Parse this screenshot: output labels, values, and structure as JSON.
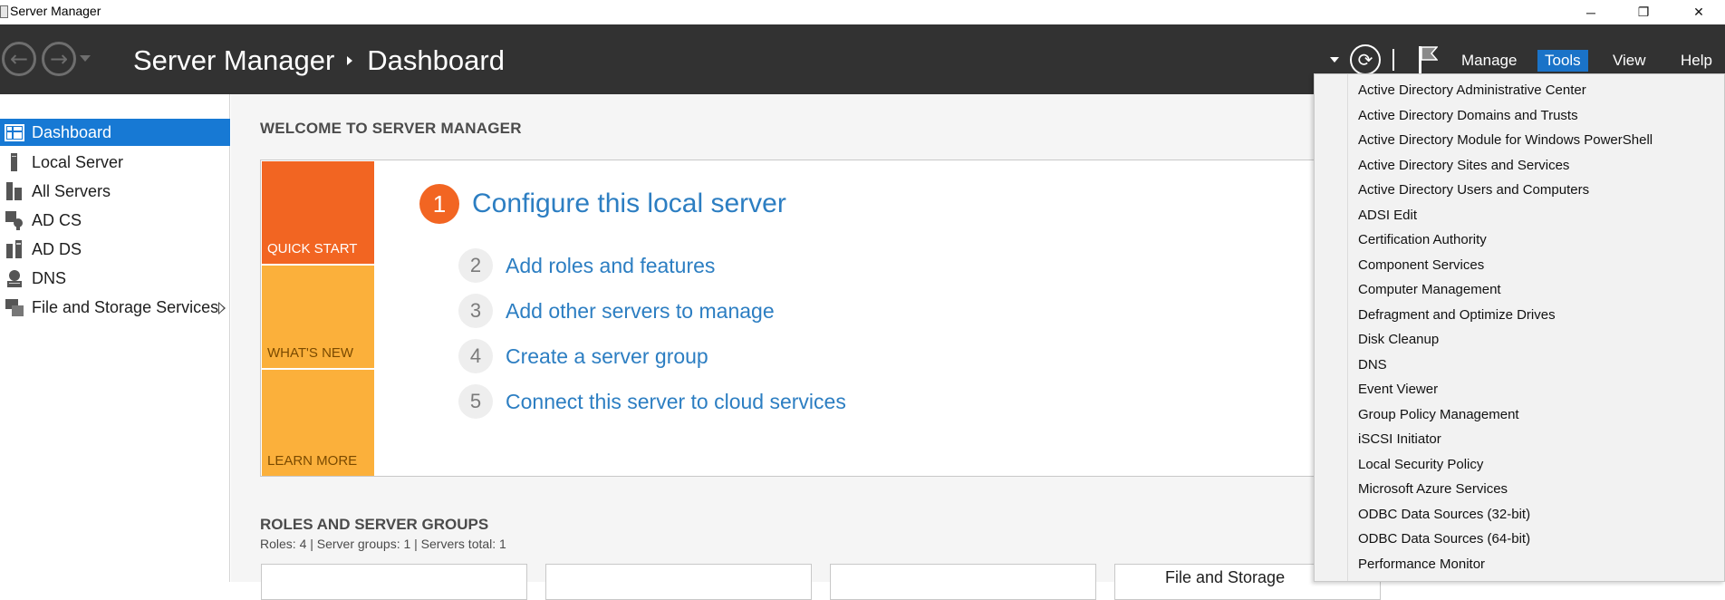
{
  "window": {
    "title": "Server Manager",
    "minimize_glyph": "─",
    "restore_glyph": "❐",
    "close_glyph": "✕"
  },
  "header": {
    "back_glyph": "←",
    "forward_glyph": "→",
    "breadcrumb": [
      "Server Manager",
      "Dashboard"
    ],
    "refresh_glyph": "⟳",
    "menus": [
      {
        "label": "Manage",
        "active": false
      },
      {
        "label": "Tools",
        "active": true
      },
      {
        "label": "View",
        "active": false
      },
      {
        "label": "Help",
        "active": false
      }
    ],
    "accent_color": "#1a73c8"
  },
  "sidebar": {
    "items": [
      {
        "label": "Dashboard",
        "icon": "dashboard-icon",
        "active": true
      },
      {
        "label": "Local Server",
        "icon": "server-icon",
        "active": false
      },
      {
        "label": "All Servers",
        "icon": "servers-icon",
        "active": false
      },
      {
        "label": "AD CS",
        "icon": "certificate-server-icon",
        "active": false
      },
      {
        "label": "AD DS",
        "icon": "directory-server-icon",
        "active": false
      },
      {
        "label": "DNS",
        "icon": "dns-server-icon",
        "active": false
      },
      {
        "label": "File and Storage Services",
        "icon": "storage-server-icon",
        "active": false,
        "expandable": true
      }
    ]
  },
  "main": {
    "welcome_title": "WELCOME TO SERVER MANAGER",
    "tiles": [
      "QUICK START",
      "WHAT'S NEW",
      "LEARN MORE"
    ],
    "steps": [
      {
        "num": "1",
        "label": "Configure this local server"
      },
      {
        "num": "2",
        "label": "Add roles and features"
      },
      {
        "num": "3",
        "label": "Add other servers to manage"
      },
      {
        "num": "4",
        "label": "Create a server group"
      },
      {
        "num": "5",
        "label": "Connect this server to cloud services"
      }
    ],
    "roles_title": "ROLES AND SERVER GROUPS",
    "roles_summary": "Roles: 4   |   Server groups: 1   |   Servers total: 1",
    "role_cards": [
      "",
      "",
      "",
      "File and Storage"
    ]
  },
  "tools_menu": {
    "items": [
      "Active Directory Administrative Center",
      "Active Directory Domains and Trusts",
      "Active Directory Module for Windows PowerShell",
      "Active Directory Sites and Services",
      "Active Directory Users and Computers",
      "ADSI Edit",
      "Certification Authority",
      "Component Services",
      "Computer Management",
      "Defragment and Optimize Drives",
      "Disk Cleanup",
      "DNS",
      "Event Viewer",
      "Group Policy Management",
      "iSCSI Initiator",
      "Local Security Policy",
      "Microsoft Azure Services",
      "ODBC Data Sources (32-bit)",
      "ODBC Data Sources (64-bit)",
      "Performance Monitor"
    ]
  }
}
